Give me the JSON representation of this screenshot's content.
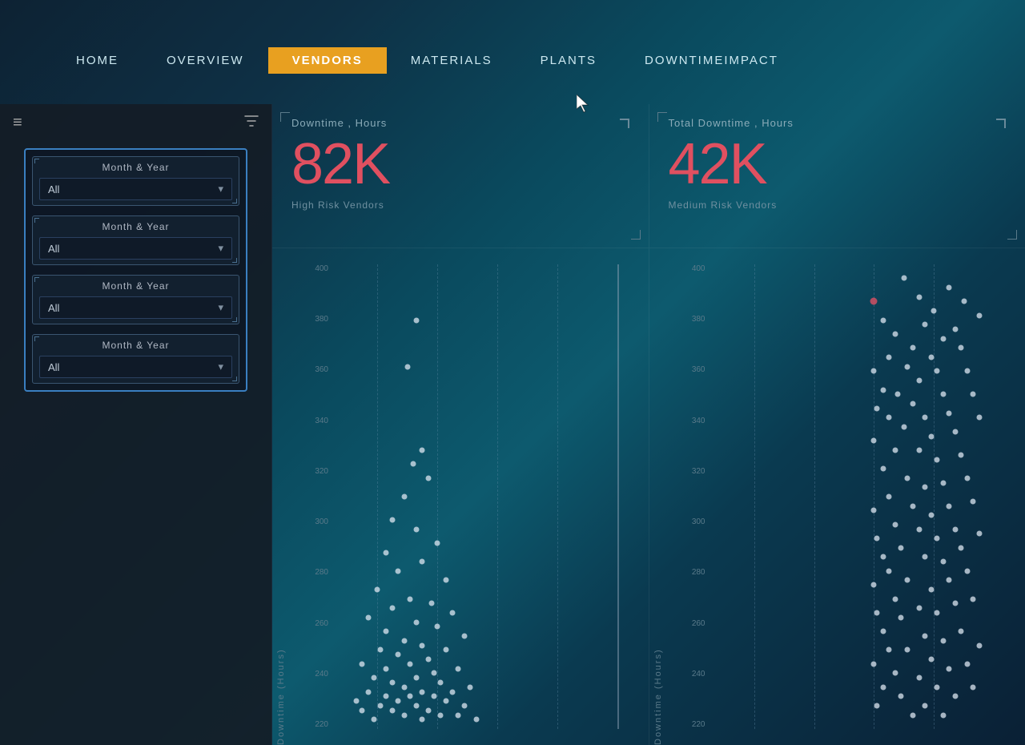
{
  "nav": {
    "items": [
      {
        "label": "Home",
        "active": false
      },
      {
        "label": "Overview",
        "active": false
      },
      {
        "label": "Vendors",
        "active": true
      },
      {
        "label": "Materials",
        "active": false
      },
      {
        "label": "Plants",
        "active": false
      },
      {
        "label": "DowntimeImpact",
        "active": false
      }
    ]
  },
  "sidebar": {
    "filters": [
      {
        "label": "Month & Year",
        "value": "All"
      },
      {
        "label": "Month & Year",
        "value": "All"
      },
      {
        "label": "Month & Year",
        "value": "All"
      },
      {
        "label": "Month & Year",
        "value": "All"
      }
    ]
  },
  "stats": [
    {
      "label": "Downtime , Hours",
      "value": "82K",
      "sublabel": "High Risk Vendors"
    },
    {
      "label": "Total Downtime , Hours",
      "value": "42K",
      "sublabel": "Medium Risk Vendors"
    }
  ],
  "charts": [
    {
      "yLabel": "Downtime (Hours)",
      "yTicks": [
        "400",
        "380",
        "360",
        "340",
        "320",
        "300",
        "280",
        "260",
        "240",
        "220"
      ]
    },
    {
      "yLabel": "Downtime (Hours)",
      "yTicks": [
        "400",
        "380",
        "360",
        "340",
        "320",
        "300",
        "280",
        "260",
        "240",
        "220"
      ]
    }
  ],
  "icons": {
    "hamburger": "≡",
    "filter": "⛉",
    "chevron": "▾"
  }
}
